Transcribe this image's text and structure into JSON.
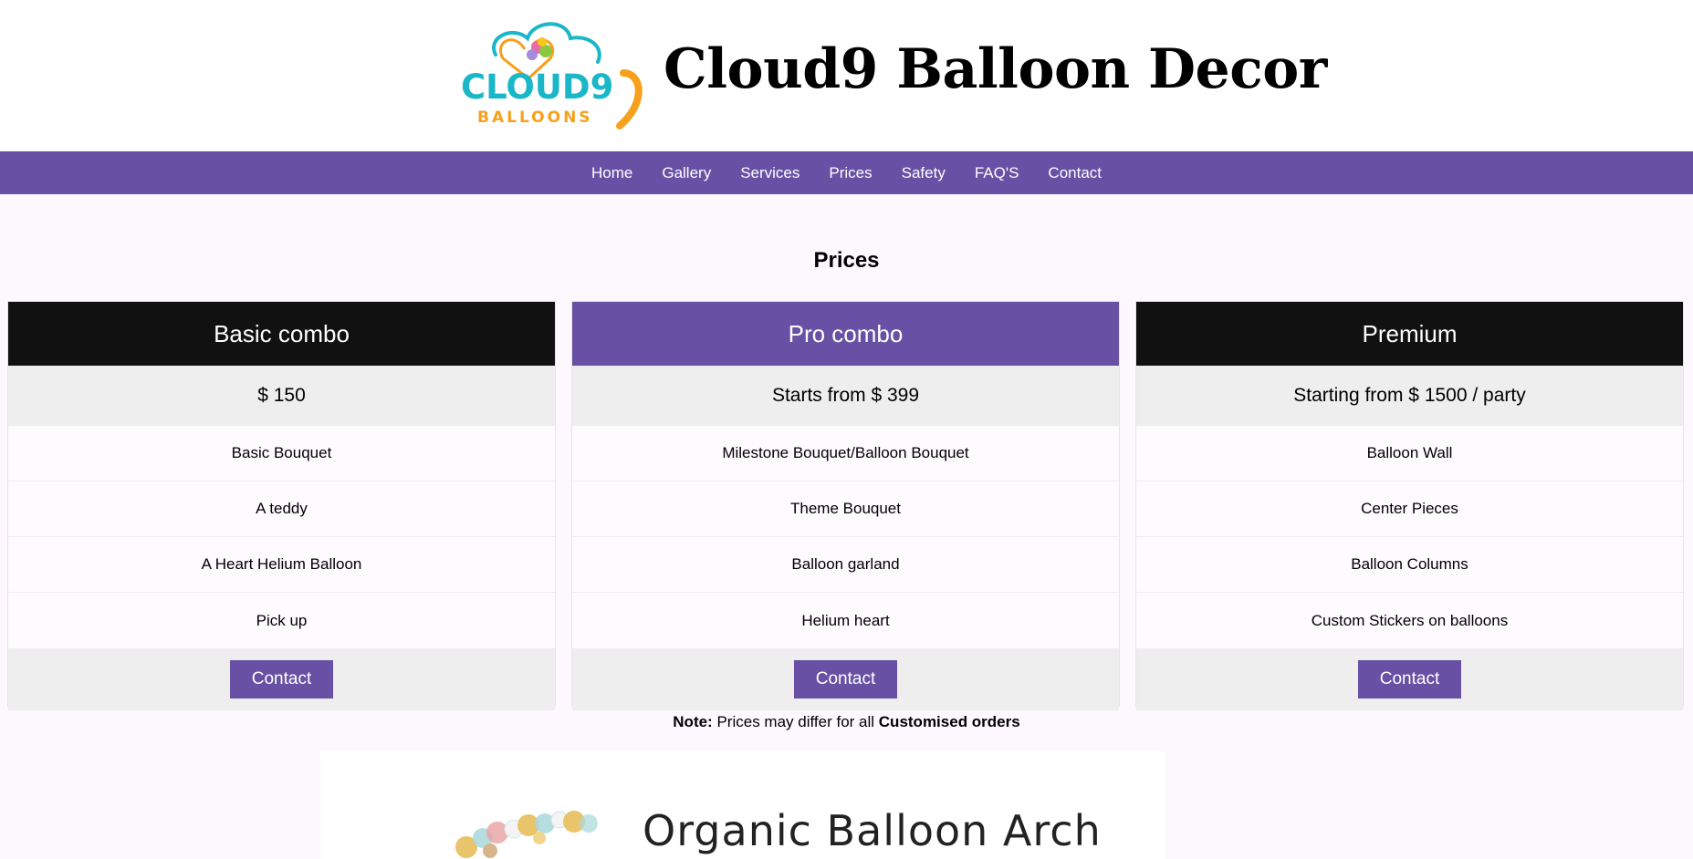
{
  "header": {
    "logo": {
      "top_text": "CLOUD9",
      "bottom_text": "BALLOONS",
      "colors": {
        "teal": "#1ab7c8",
        "orange": "#f7a01c",
        "purple": "#6850a4"
      }
    },
    "title": "Cloud9 Balloon Decor"
  },
  "nav": {
    "items": [
      {
        "label": "Home"
      },
      {
        "label": "Gallery"
      },
      {
        "label": "Services"
      },
      {
        "label": "Prices"
      },
      {
        "label": "Safety"
      },
      {
        "label": "FAQ'S"
      },
      {
        "label": "Contact"
      }
    ],
    "background": "#6850a4"
  },
  "main": {
    "heading": "Prices",
    "plans": [
      {
        "name": "Basic combo",
        "header_style": "dark",
        "price": "$ 150",
        "features": [
          "Basic Bouquet",
          "A teddy",
          "A Heart Helium Balloon",
          "Pick up"
        ],
        "button": "Contact"
      },
      {
        "name": "Pro combo",
        "header_style": "purple",
        "price": "Starts from $ 399",
        "features": [
          "Milestone Bouquet/Balloon Bouquet",
          "Theme Bouquet",
          "Balloon garland",
          "Helium heart"
        ],
        "button": "Contact"
      },
      {
        "name": "Premium",
        "header_style": "dark",
        "price": "Starting from $ 1500 / party",
        "features": [
          "Balloon Wall",
          "Center Pieces",
          "Balloon Columns",
          "Custom Stickers on balloons"
        ],
        "button": "Contact"
      }
    ],
    "note": {
      "label": "Note:",
      "text": "Prices may differ for all",
      "emphasis": "Customised orders"
    },
    "promo": {
      "title": "Organic Balloon Arch"
    }
  },
  "colors": {
    "accent": "#6850a4",
    "dark_header": "#111111",
    "row_gray": "#eeeeee",
    "page_bg": "#fdf8fd"
  }
}
